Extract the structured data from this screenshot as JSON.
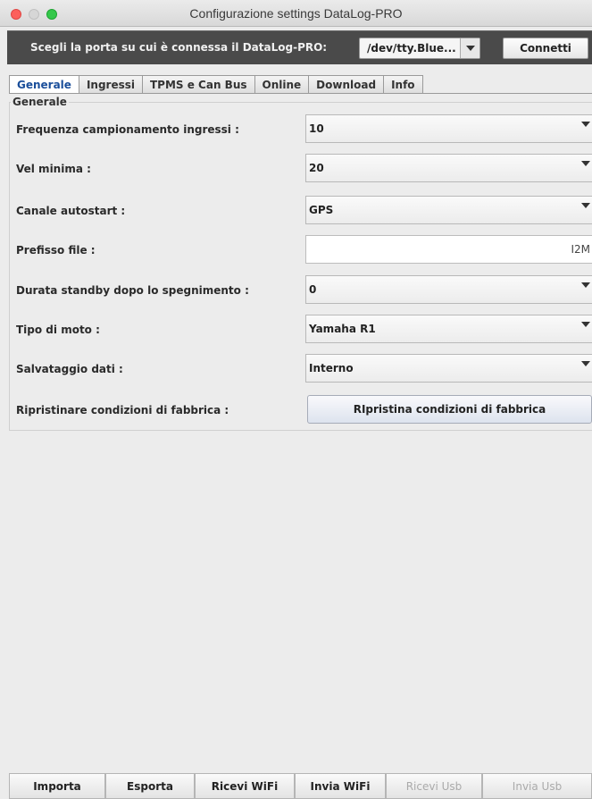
{
  "window": {
    "title": "Configurazione settings DataLog-PRO"
  },
  "portbar": {
    "label": "Scegli la porta su cui è connessa il DataLog-PRO:",
    "port_value": "/dev/tty.Blue...",
    "connect_label": "Connetti"
  },
  "tabs": [
    {
      "label": "Generale",
      "active": true
    },
    {
      "label": "Ingressi",
      "active": false
    },
    {
      "label": "TPMS e Can Bus",
      "active": false
    },
    {
      "label": "Online",
      "active": false
    },
    {
      "label": "Download",
      "active": false
    },
    {
      "label": "Info",
      "active": false
    }
  ],
  "panel": {
    "title": "Generale",
    "rows": [
      {
        "label": "Frequenza campionamento ingressi :",
        "type": "combo",
        "value": "10"
      },
      {
        "label": "Vel minima :",
        "type": "combo",
        "value": "20"
      },
      {
        "label": "Canale autostart :",
        "type": "combo",
        "value": "GPS"
      },
      {
        "label": "Prefisso file :",
        "type": "text",
        "value": "I2M"
      },
      {
        "label": "Durata standby dopo lo spegnimento :",
        "type": "combo",
        "value": "0"
      },
      {
        "label": "Tipo di moto :",
        "type": "combo",
        "value": "Yamaha R1"
      },
      {
        "label": "Salvataggio dati :",
        "type": "combo",
        "value": "Interno"
      },
      {
        "label": "Ripristinare condizioni di fabbrica :",
        "type": "button",
        "value": "RIpristina condizioni di fabbrica"
      }
    ]
  },
  "footer": {
    "buttons": [
      {
        "label": "Importa",
        "enabled": true
      },
      {
        "label": "Esporta",
        "enabled": true
      },
      {
        "label": "Ricevi WiFi",
        "enabled": true
      },
      {
        "label": "Invia WiFi",
        "enabled": true
      },
      {
        "label": "Ricevi Usb",
        "enabled": false
      },
      {
        "label": "Invia Usb",
        "enabled": false
      }
    ]
  }
}
